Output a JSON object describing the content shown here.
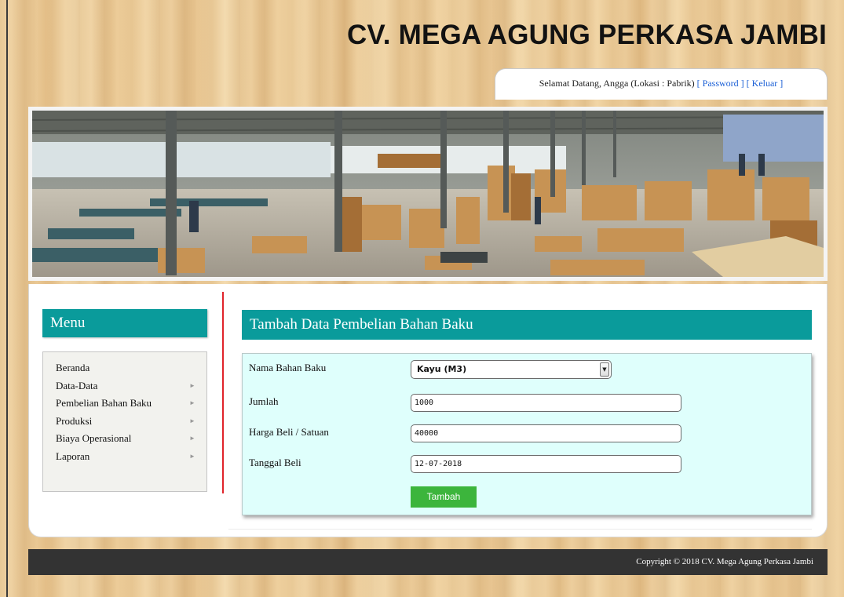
{
  "header": {
    "site_title": "CV. MEGA AGUNG PERKASA JAMBI",
    "welcome_text": "Selamat Datang, Angga (Lokasi : Pabrik)",
    "password_link": "[ Password ]",
    "logout_link": "[ Keluar ]"
  },
  "sidebar": {
    "title": "Menu",
    "items": [
      {
        "label": "Beranda"
      },
      {
        "label": "Data-Data"
      },
      {
        "label": "Pembelian Bahan Baku"
      },
      {
        "label": "Produksi"
      },
      {
        "label": "Biaya Operasional"
      },
      {
        "label": "Laporan"
      }
    ]
  },
  "form": {
    "title": "Tambah Data Pembelian Bahan Baku",
    "fields": {
      "nama_label": "Nama Bahan Baku",
      "nama_value": "Kayu (M3)",
      "jumlah_label": "Jumlah",
      "jumlah_value": "1000",
      "harga_label": "Harga Beli / Satuan",
      "harga_value": "40000",
      "tanggal_label": "Tanggal Beli",
      "tanggal_value": "12-07-2018"
    },
    "submit_label": "Tambah"
  },
  "footer": {
    "copyright": "Copyright © 2018 CV. Mega Agung Perkasa Jambi"
  },
  "colors": {
    "accent_teal": "#0a9b9b",
    "divider_red": "#e0242a",
    "button_green": "#3cb53c",
    "footer_dark": "#333333",
    "form_bg": "#dffffc"
  }
}
